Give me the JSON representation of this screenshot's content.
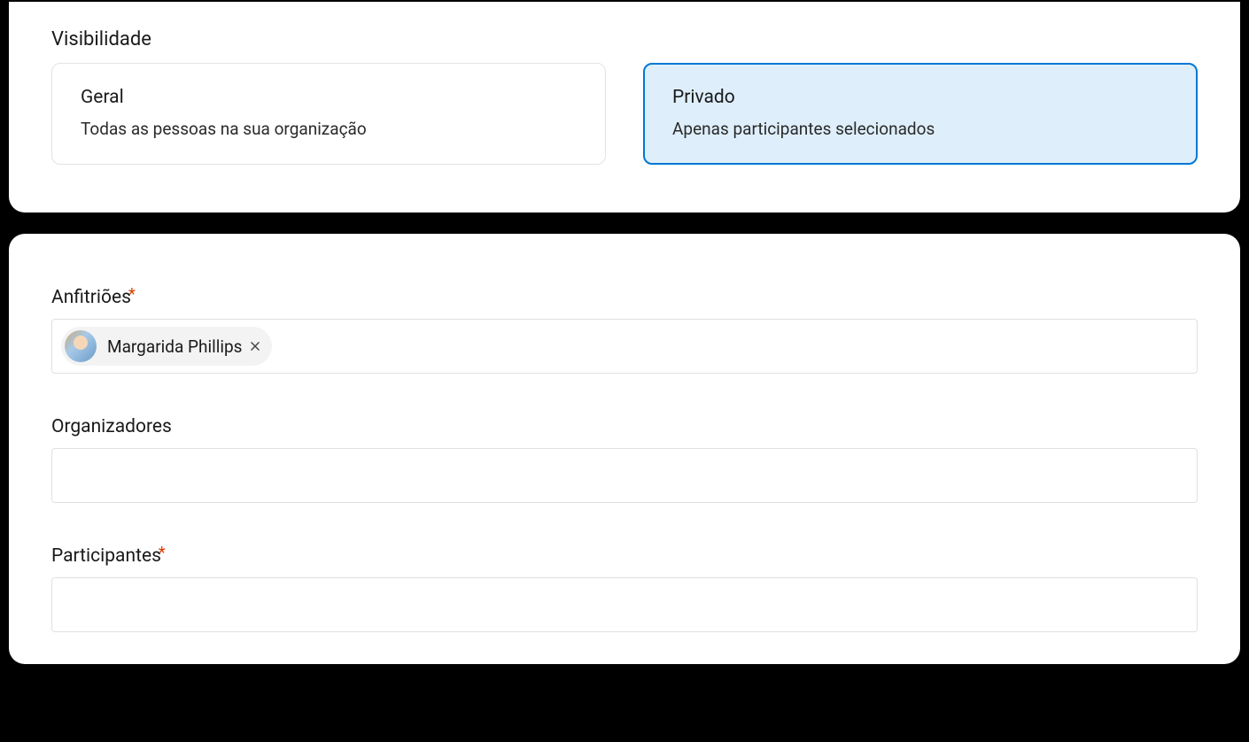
{
  "visibility": {
    "section_title": "Visibilidade",
    "options": {
      "general": {
        "title": "Geral",
        "description": "Todas as pessoas na sua organização",
        "selected": false
      },
      "private": {
        "title": "Privado",
        "description": "Apenas participantes selecionados",
        "selected": true
      }
    }
  },
  "fields": {
    "hosts": {
      "label": "Anfitriões",
      "required": true,
      "chips": [
        {
          "name": "Margarida Phillips"
        }
      ]
    },
    "organizers": {
      "label": "Organizadores",
      "required": false,
      "chips": []
    },
    "participants": {
      "label": "Participantes",
      "required": true,
      "chips": []
    }
  }
}
